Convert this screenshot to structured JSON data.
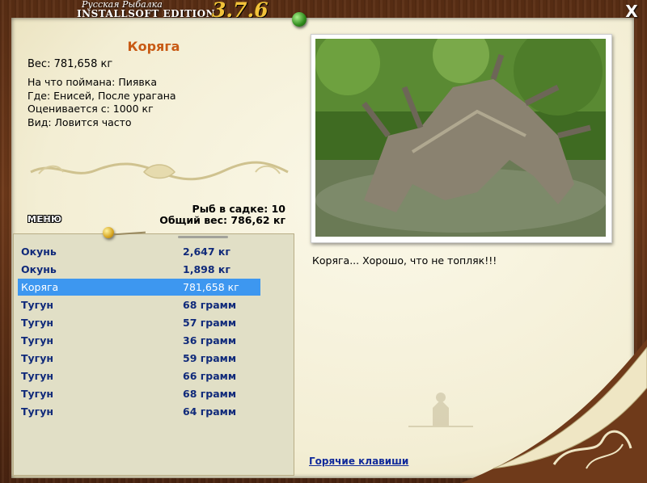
{
  "app": {
    "title_line1": "Русская Рыбалка",
    "title_line2": "INSTALLSOFT EDITION",
    "version": "3.7.6",
    "close_label": "X"
  },
  "fish_card": {
    "name": "Коряга",
    "weight": "Вес: 781,658 кг",
    "caught_on": "На что поймана: Пиявка",
    "location": "Где: Енисей, После урагана",
    "valued_from": "Оценивается с: 1000 кг",
    "frequency": "Вид: Ловится часто"
  },
  "menu_label": "МЕНЮ",
  "stats": {
    "fish_count": "Рыб в садке: 10",
    "total_weight": "Общий вес: 786,62 кг"
  },
  "catch_list": [
    {
      "name": "Окунь",
      "weight": "2,647 кг",
      "selected": false
    },
    {
      "name": "Окунь",
      "weight": "1,898 кг",
      "selected": false
    },
    {
      "name": "Коряга",
      "weight": "781,658 кг",
      "selected": true
    },
    {
      "name": "Тугун",
      "weight": "68 грамм",
      "selected": false
    },
    {
      "name": "Тугун",
      "weight": "57 грамм",
      "selected": false
    },
    {
      "name": "Тугун",
      "weight": "36 грамм",
      "selected": false
    },
    {
      "name": "Тугун",
      "weight": "59 грамм",
      "selected": false
    },
    {
      "name": "Тугун",
      "weight": "66 грамм",
      "selected": false
    },
    {
      "name": "Тугун",
      "weight": "68 грамм",
      "selected": false
    },
    {
      "name": "Тугун",
      "weight": "64 грамм",
      "selected": false
    }
  ],
  "comment": "Коряга... Хорошо, что не топляк!!!",
  "hotkeys_label": "Горячие клавиши",
  "colors": {
    "wood": "#6f3a1a",
    "parchment": "#f3eed4",
    "selection": "#3d97f0",
    "fish_name": "#c85a14",
    "list_text": "#102a7a",
    "version": "#f2c23a"
  }
}
